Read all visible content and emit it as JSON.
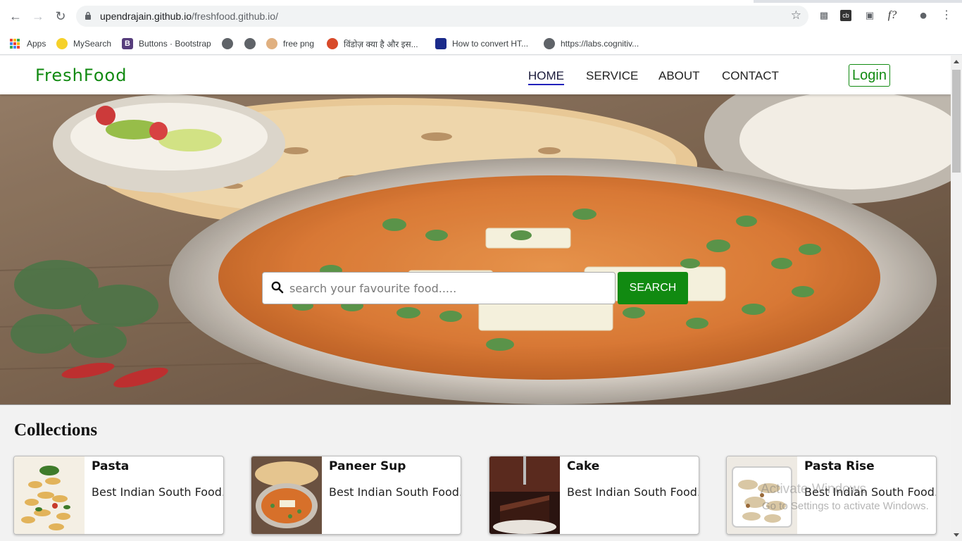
{
  "browser": {
    "url_host": "upendrajain.github.io",
    "url_path": "/freshfood.github.io/",
    "bookmarks": [
      {
        "label": "Apps"
      },
      {
        "label": "MySearch"
      },
      {
        "label": "Buttons · Bootstrap"
      },
      {
        "label": ""
      },
      {
        "label": ""
      },
      {
        "label": "free png"
      },
      {
        "label": "विंडोज़ क्या है और इस..."
      },
      {
        "label": "How to convert HT..."
      },
      {
        "label": "https://labs.cognitiv..."
      }
    ]
  },
  "site": {
    "logo": "FreshFood",
    "nav": [
      "HOME",
      "SERVICE",
      "ABOUT",
      "CONTACT"
    ],
    "login": "Login"
  },
  "hero": {
    "search_placeholder": "search your favourite food.....",
    "search_button": "SEARCH"
  },
  "collections": {
    "title": "Collections",
    "items": [
      {
        "name": "Pasta",
        "desc": "Best Indian South Food."
      },
      {
        "name": "Paneer Sup",
        "desc": "Best Indian South Food."
      },
      {
        "name": "Cake",
        "desc": "Best Indian South Food."
      },
      {
        "name": "Pasta Rise",
        "desc": "Best Indian South Food."
      }
    ]
  },
  "watermark": {
    "line1": "Activate Windows",
    "line2": "Go to Settings to activate Windows."
  },
  "colors": {
    "brand_green": "#118a11",
    "nav_active_underline": "#2222bb"
  }
}
